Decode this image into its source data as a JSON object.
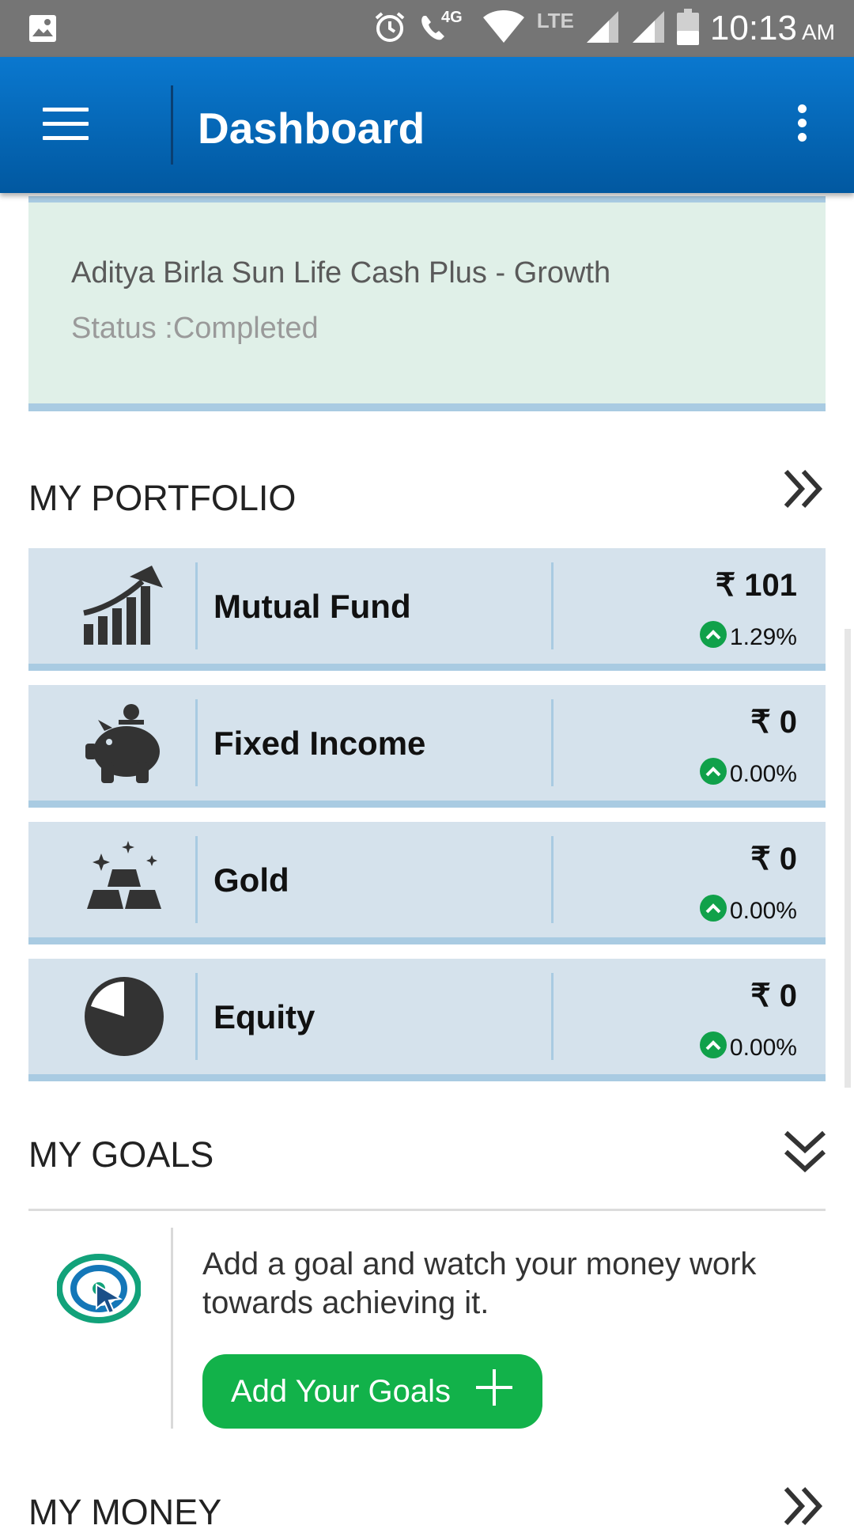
{
  "status_bar": {
    "network_4g": "4G",
    "network_lte": "LTE",
    "time": "10:13",
    "ampm": "AM"
  },
  "app_bar": {
    "title": "Dashboard"
  },
  "transaction": {
    "fund_name": "Aditya Birla Sun Life Cash Plus - Growth",
    "status": "Status :Completed"
  },
  "portfolio": {
    "title": "MY PORTFOLIO",
    "items": [
      {
        "label": "Mutual Fund",
        "amount": "₹ 101",
        "change": "1.29%",
        "icon": "growth-chart-icon"
      },
      {
        "label": "Fixed Income",
        "amount": "₹ 0",
        "change": "0.00%",
        "icon": "piggy-bank-icon"
      },
      {
        "label": "Gold",
        "amount": "₹ 0",
        "change": "0.00%",
        "icon": "gold-bars-icon"
      },
      {
        "label": "Equity",
        "amount": "₹ 0",
        "change": "0.00%",
        "icon": "pie-chart-icon"
      }
    ]
  },
  "goals": {
    "title": "MY GOALS",
    "description": "Add a goal and watch your money work towards achieving it.",
    "button_label": "Add Your Goals"
  },
  "money": {
    "title": "MY MONEY"
  },
  "colors": {
    "app_bar": "#0a6cbf",
    "status_bar": "#757575",
    "card_green": "#e0f0e8",
    "row_bg": "#d5e2ec",
    "accent_border": "#a9cbe2",
    "positive": "#10a14a"
  }
}
